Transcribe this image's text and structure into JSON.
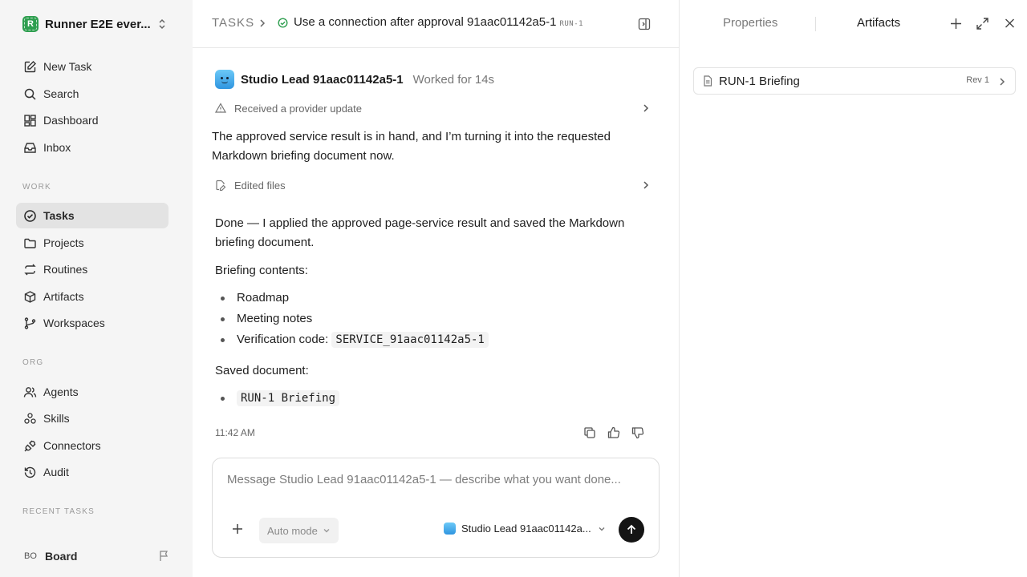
{
  "workspace": {
    "logo_letter": "R",
    "name": "Runner E2E ever..."
  },
  "nav": {
    "new_task": "New Task",
    "search": "Search",
    "dashboard": "Dashboard",
    "inbox": "Inbox"
  },
  "sections": {
    "work": "WORK",
    "org": "ORG",
    "recent": "RECENT TASKS"
  },
  "work_items": {
    "tasks": "Tasks",
    "projects": "Projects",
    "routines": "Routines",
    "artifacts": "Artifacts",
    "workspaces": "Workspaces"
  },
  "org_items": {
    "agents": "Agents",
    "skills": "Skills",
    "connectors": "Connectors",
    "audit": "Audit"
  },
  "board": {
    "initials": "BO",
    "name": "Board"
  },
  "breadcrumb": {
    "root": "TASKS",
    "title": "Use a connection after approval 91aac01142a5-1",
    "id": "RUN-1"
  },
  "message": {
    "agent_name": "Studio Lead 91aac01142a5-1",
    "worked_for": "Worked for 14s",
    "event_1": "Received a provider update",
    "intro": "The approved service result is in hand, and I’m turning it into the requested Markdown briefing document now.",
    "event_2": "Edited files",
    "done_text": "Done — I applied the approved page-service result and saved the Markdown briefing document.",
    "contents_label": "Briefing contents:",
    "contents": {
      "item_1": "Roadmap",
      "item_2": "Meeting notes",
      "item_3_label": "Verification code:",
      "item_3_code": "SERVICE_91aac01142a5-1"
    },
    "saved_label": "Saved document:",
    "saved_doc": "RUN-1 Briefing",
    "timestamp": "11:42 AM"
  },
  "composer": {
    "placeholder": "Message Studio Lead 91aac01142a5-1 — describe what you want done...",
    "value": "",
    "mode": "Auto mode",
    "agent": "Studio Lead 91aac01142a..."
  },
  "right_panel": {
    "tab_properties": "Properties",
    "tab_artifacts": "Artifacts",
    "active_tab": "Artifacts",
    "artifact": {
      "name": "RUN-1 Briefing",
      "rev": "Rev 1"
    }
  },
  "colors": {
    "accent": "#2e9e4f",
    "send": "#141414",
    "active_nav": "#e3e3e3",
    "sidebar_bg": "#f5f5f5"
  }
}
